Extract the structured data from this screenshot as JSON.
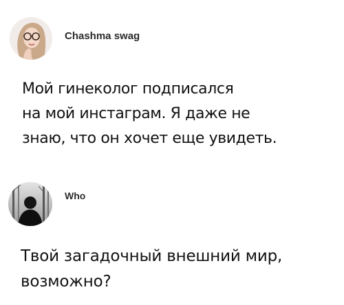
{
  "posts": [
    {
      "username": "Chashma swag",
      "avatar_icon": "woman-with-glasses-avatar",
      "text_lines": [
        "Мой гинеколог подписался",
        "на мой инстаграм. Я даже не",
        "знаю, что он хочет еще увидеть."
      ]
    },
    {
      "username": "Who",
      "avatar_icon": "silhouette-in-forest-avatar",
      "text_lines": [
        "Твой загадочный внешний мир,",
        "возможно?"
      ]
    }
  ]
}
